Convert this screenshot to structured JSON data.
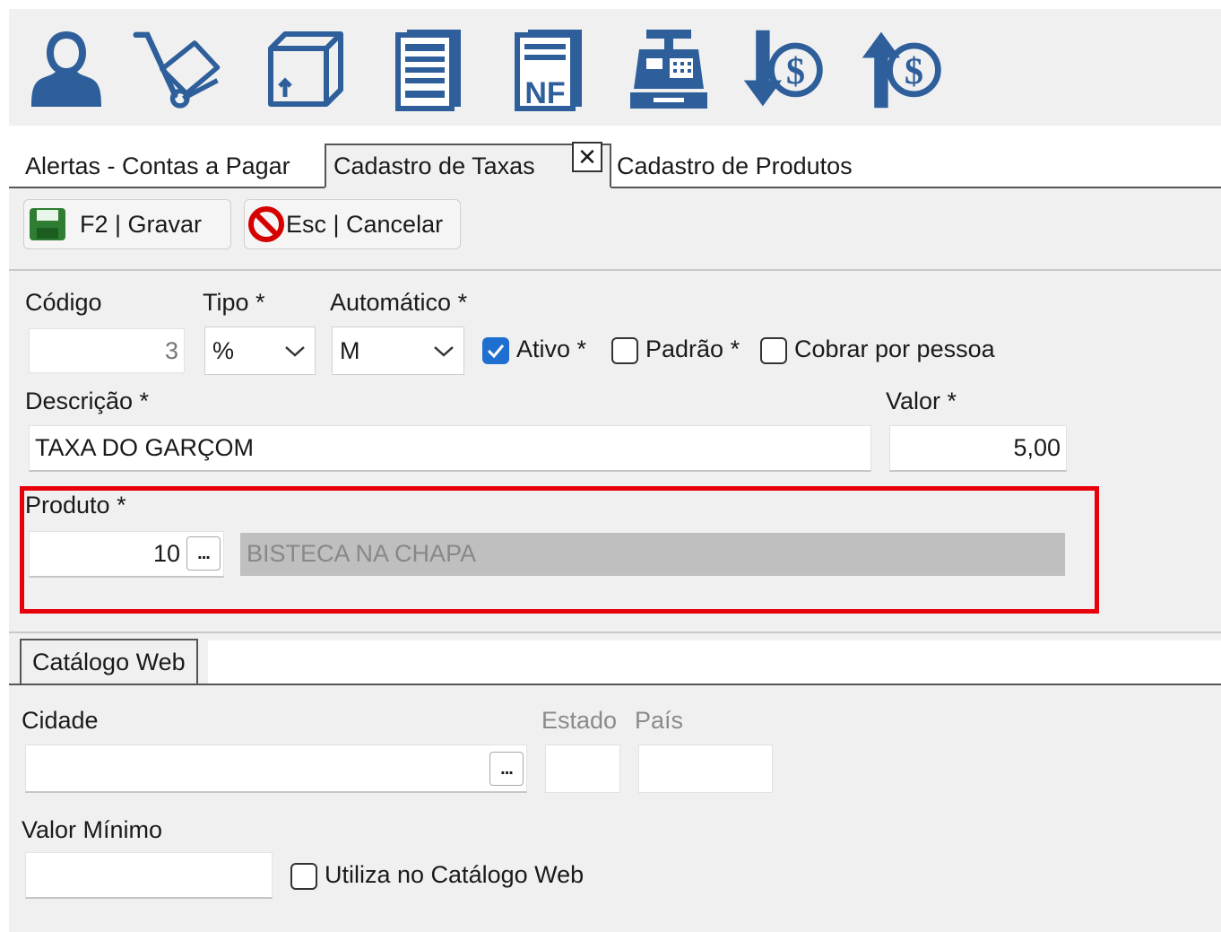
{
  "ribbon": {
    "icons": [
      "user-icon",
      "hand-truck-icon",
      "box-icon",
      "document-icon",
      "nf-invoice-icon",
      "cash-register-icon",
      "money-in-icon",
      "money-out-icon"
    ],
    "nf_text": "NF",
    "dollar_text": "$"
  },
  "tabs": {
    "items": [
      {
        "label": "Alertas - Contas a Pagar"
      },
      {
        "label": "Cadastro de Taxas"
      },
      {
        "label": "Cadastro de Produtos"
      }
    ],
    "close_glyph": "✕",
    "active_index": 1
  },
  "toolbar": {
    "save_label": "F2 | Gravar",
    "cancel_label": "Esc | Cancelar"
  },
  "form": {
    "codigo_label": "Código",
    "codigo_value": "3",
    "tipo_label": "Tipo *",
    "tipo_value": "%",
    "automatico_label": "Automático *",
    "automatico_value": "M",
    "ativo_label": "Ativo *",
    "ativo_checked": true,
    "padrao_label": "Padrão *",
    "padrao_checked": false,
    "cobrar_label": "Cobrar por pessoa",
    "cobrar_checked": false,
    "descricao_label": "Descrição *",
    "descricao_value": "TAXA DO GARÇOM",
    "valor_label": "Valor *",
    "valor_value": "5,00",
    "produto_label": "Produto *",
    "produto_code": "10",
    "produto_name": "BISTECA NA CHAPA",
    "lookup_glyph": "..."
  },
  "catalogo": {
    "tab_label": "Catálogo Web",
    "cidade_label": "Cidade",
    "estado_label": "Estado",
    "pais_label": "País",
    "valor_minimo_label": "Valor Mínimo",
    "utiliza_label": "Utiliza no Catálogo Web",
    "utiliza_checked": false,
    "lookup_glyph": "..."
  },
  "colors": {
    "ribbon_blue": "#2e5f9b",
    "highlight_red": "#e8000b",
    "check_blue": "#1f6fd1",
    "save_green": "#2e7d32",
    "cancel_red": "#d50000"
  }
}
